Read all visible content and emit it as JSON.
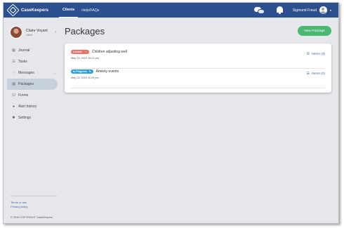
{
  "header": {
    "logo_text": "CaseKeepers",
    "nav": [
      "Clients",
      "Help/FAQs"
    ],
    "user_name": "Sigmund Freud",
    "user_caret": "▾",
    "bg_color": "#2c4f8e"
  },
  "profile": {
    "name": "Claire Voyant",
    "role": "Client",
    "chevron": "›"
  },
  "sidebar": {
    "items": [
      {
        "label": "Journal",
        "icon": "journal-icon",
        "glyph": "▤"
      },
      {
        "label": "Tasks",
        "icon": "tasks-icon",
        "glyph": "☷"
      },
      {
        "label": "Messages",
        "icon": "messages-icon",
        "glyph": "◌",
        "caret": "›"
      },
      {
        "label": "Packages",
        "icon": "packages-icon",
        "glyph": "▤"
      },
      {
        "label": "Forms",
        "icon": "forms-icon",
        "glyph": "☑"
      },
      {
        "label": "Alert history",
        "icon": "alert-icon",
        "glyph": "●"
      },
      {
        "label": "Settings",
        "icon": "settings-icon",
        "glyph": "✱"
      }
    ],
    "active_index": 3,
    "footer_links": [
      "Terms of use",
      "Privacy policy"
    ],
    "copyright": "© 2019 COPYRIGHT CaseKeepers"
  },
  "main": {
    "title": "Packages",
    "new_button": "New Package",
    "packages": [
      {
        "badge": "Locked",
        "badge_color": "#e8706a",
        "badge_glyph": "🔒",
        "title": "Children adjusting well",
        "date": "May 23, 2019 10:22 pm",
        "items": "Items (3)",
        "items_glyph": "☰"
      },
      {
        "badge": "In Progress",
        "badge_color": "#2e9fd8",
        "badge_glyph": "✎",
        "title": "Anxiety events",
        "date": "May 23, 2019 11:19 pm",
        "items": "Items (2)",
        "items_glyph": "☰"
      }
    ]
  }
}
